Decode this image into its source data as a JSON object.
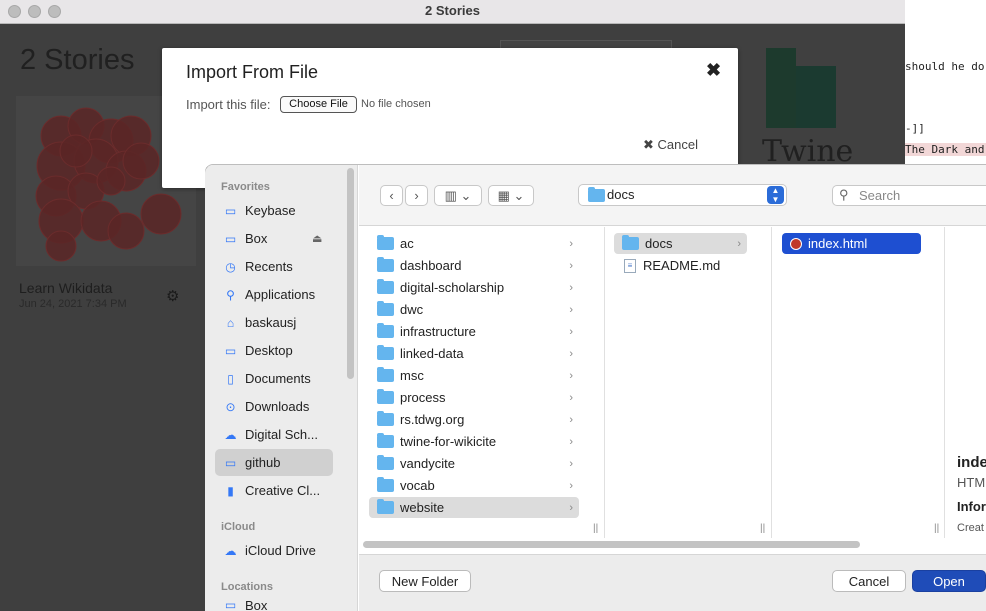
{
  "right_bg": {
    "lines": [
      "should he do",
      "-]]",
      "The Dark and"
    ]
  },
  "twine": {
    "window_title": "2 Stories",
    "heading": "2 Stories",
    "story": {
      "title": "Learn Wikidata",
      "date": "Jun 24, 2021 7:34 PM"
    },
    "logo_word": "Twine"
  },
  "modal": {
    "title": "Import From File",
    "label": "Import this file:",
    "choose_button": "Choose File",
    "no_file": "No file chosen",
    "cancel": "Cancel"
  },
  "dialog": {
    "sidebar": {
      "favorites_header": "Favorites",
      "favorites": [
        {
          "label": "Keybase",
          "icon": "drive-icon"
        },
        {
          "label": "Box",
          "icon": "drive-icon"
        },
        {
          "label": "Recents",
          "icon": "clock-icon"
        },
        {
          "label": "Applications",
          "icon": "applications-icon"
        },
        {
          "label": "baskausj",
          "icon": "home-icon"
        },
        {
          "label": "Desktop",
          "icon": "desktop-icon"
        },
        {
          "label": "Documents",
          "icon": "document-icon"
        },
        {
          "label": "Downloads",
          "icon": "download-icon"
        },
        {
          "label": "Digital Sch...",
          "icon": "cloud-icon"
        },
        {
          "label": "github",
          "icon": "folder-icon"
        },
        {
          "label": "Creative Cl...",
          "icon": "document-icon"
        }
      ],
      "icloud_header": "iCloud",
      "icloud": [
        {
          "label": "iCloud Drive",
          "icon": "cloud-icon"
        }
      ],
      "locations_header": "Locations",
      "locations": [
        {
          "label": "Box",
          "icon": "drive-icon"
        }
      ]
    },
    "location": "docs",
    "search_placeholder": "Search",
    "col1": [
      "ac",
      "dashboard",
      "digital-scholarship",
      "dwc",
      "infrastructure",
      "linked-data",
      "msc",
      "process",
      "rs.tdwg.org",
      "twine-for-wikicite",
      "vandycite",
      "vocab",
      "website"
    ],
    "col2": [
      "docs",
      "README.md"
    ],
    "col3": [
      "index.html"
    ],
    "preview": {
      "name": "inde",
      "kind": "HTM",
      "info": "Infor",
      "created": "Creat"
    },
    "buttons": {
      "new_folder": "New Folder",
      "cancel": "Cancel",
      "open": "Open"
    }
  }
}
